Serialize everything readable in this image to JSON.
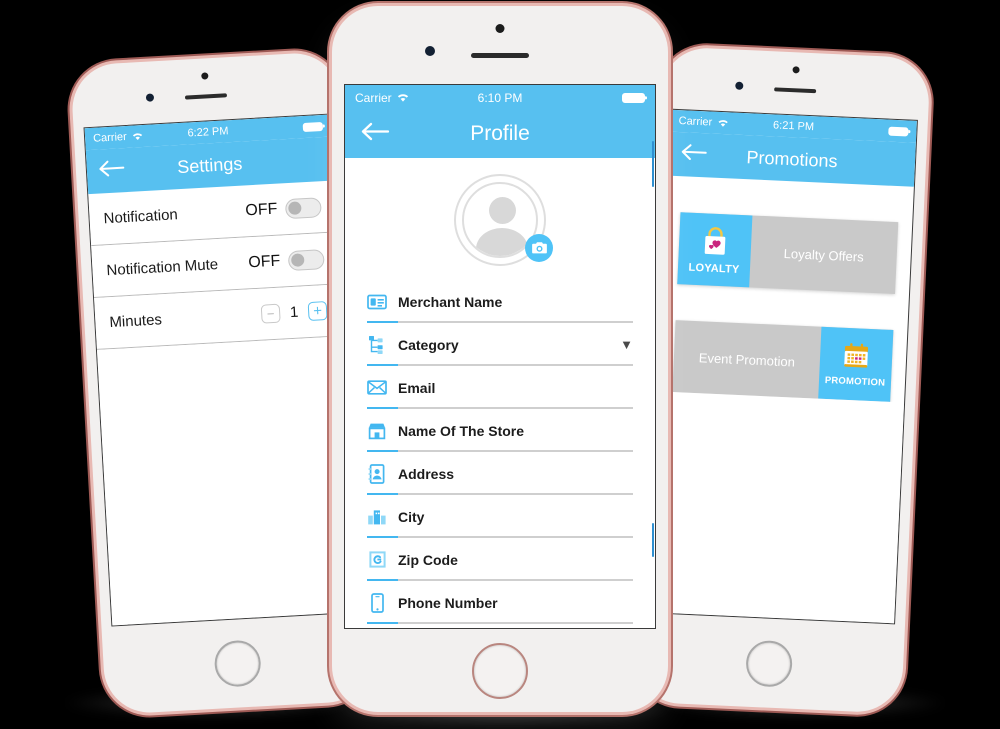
{
  "scene": {
    "background_color": "#000000",
    "accent_blue": "#57C0F0",
    "card_gray": "#C9C9C9",
    "phone_body_color": "#F2F0EF",
    "phone_edge_color": "#E8B9B3"
  },
  "left_phone": {
    "status_bar": {
      "carrier": "Carrier",
      "wifi_icon": "wifi-icon",
      "time": "6:22 PM",
      "battery_icon": "battery-icon"
    },
    "nav": {
      "back_icon": "back-arrow-icon",
      "title": "Settings"
    },
    "rows": [
      {
        "label": "Notification",
        "value": "OFF",
        "control": "toggle",
        "state": "off"
      },
      {
        "label": "Notification Mute",
        "value": "OFF",
        "control": "toggle",
        "state": "off"
      },
      {
        "label": "Minutes",
        "control": "stepper",
        "minus_label": "−",
        "value": "1",
        "plus_label": "+"
      }
    ]
  },
  "center_phone": {
    "status_bar": {
      "carrier": "Carrier",
      "wifi_icon": "wifi-icon",
      "time": "6:10 PM",
      "battery_icon": "battery-icon"
    },
    "nav": {
      "back_icon": "back-arrow-icon",
      "title": "Profile"
    },
    "avatar": {
      "icon": "user-avatar-icon",
      "camera_badge_icon": "camera-icon"
    },
    "fields": [
      {
        "label": "Merchant Name",
        "icon": "id-card-icon",
        "caret": ""
      },
      {
        "label": "Category",
        "icon": "sitemap-icon",
        "caret": "▼"
      },
      {
        "label": "Email",
        "icon": "envelope-icon",
        "caret": ""
      },
      {
        "label": "Name Of The Store",
        "icon": "storefront-icon",
        "caret": ""
      },
      {
        "label": "Address",
        "icon": "address-book-icon",
        "caret": ""
      },
      {
        "label": "City",
        "icon": "buildings-icon",
        "caret": ""
      },
      {
        "label": "Zip Code",
        "icon": "postal-stamp-icon",
        "caret": ""
      },
      {
        "label": "Phone Number",
        "icon": "mobile-phone-icon",
        "caret": ""
      }
    ]
  },
  "right_phone": {
    "status_bar": {
      "carrier": "Carrier",
      "wifi_icon": "wifi-icon",
      "time": "6:21 PM",
      "battery_icon": "battery-icon"
    },
    "nav": {
      "back_icon": "back-arrow-icon",
      "title": "Promotions"
    },
    "cards": [
      {
        "title": "Loyalty Offers",
        "thumb_label": "LOYALTY",
        "thumb_icon": "shopping-bag-hearts-icon",
        "thumb_side": "left"
      },
      {
        "title": "Event Promotion",
        "thumb_label": "PROMOTION",
        "thumb_icon": "calendar-icon",
        "thumb_side": "right"
      }
    ]
  }
}
